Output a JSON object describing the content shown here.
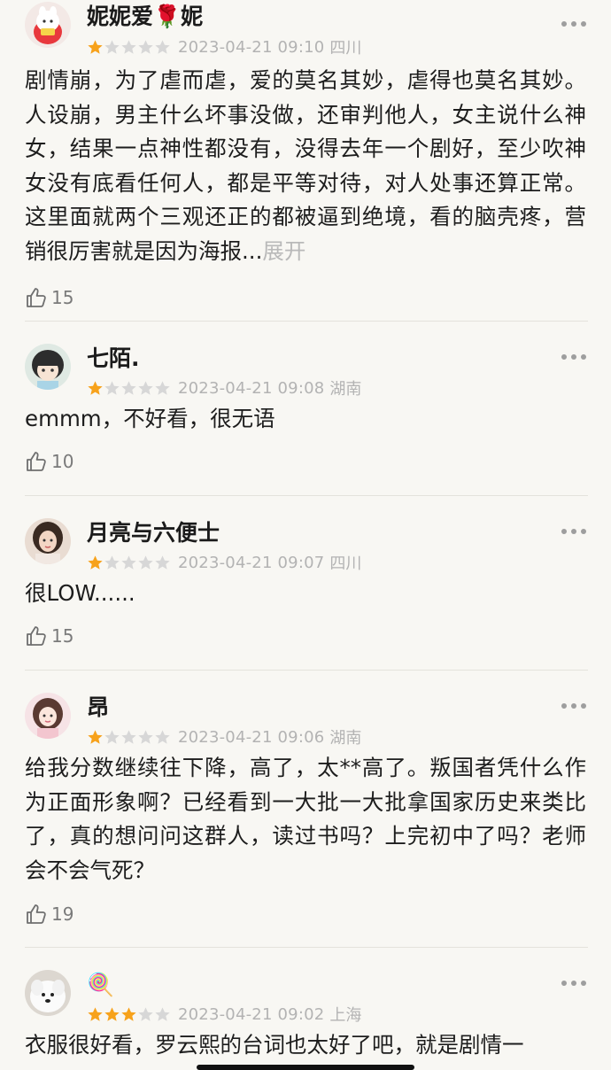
{
  "colors": {
    "background": "#f8f7f3",
    "star_filled": "#f7a21b",
    "star_empty": "#d7d7d7",
    "meta_text": "#b3b3b3"
  },
  "icons": {
    "more": "more-dots-icon",
    "like": "thumbs-up-icon",
    "star": "star-icon"
  },
  "reviews": [
    {
      "username": "妮妮爱🌹妮",
      "rating": 1,
      "max_rating": 5,
      "time": "2023-04-21 09:10",
      "region": "四川",
      "text": "剧情崩，为了虐而虐，爱的莫名其妙，虐得也莫名其妙。人设崩，男主什么坏事没做，还审判他人，女主说什么神女，结果一点神性都没有，没得去年一个剧好，至少吹神女没有底看任何人，都是平等对待，对人处事还算正常。这里面就两个三观还正的都被逼到绝境，看的脑壳疼，营销很厉害就是因为海报...",
      "expand_label": "展开",
      "likes": "15"
    },
    {
      "username": "七陌.",
      "rating": 1,
      "max_rating": 5,
      "time": "2023-04-21 09:08",
      "region": "湖南",
      "text": "emmm，不好看，很无语",
      "likes": "10"
    },
    {
      "username": "月亮与六便士",
      "rating": 1,
      "max_rating": 5,
      "time": "2023-04-21 09:07",
      "region": "四川",
      "text": "很LOW......",
      "likes": "15"
    },
    {
      "username": "昂",
      "rating": 1,
      "max_rating": 5,
      "time": "2023-04-21 09:06",
      "region": "湖南",
      "text": "给我分数继续往下降，高了，太**高了。叛国者凭什么作为正面形象啊？已经看到一大批一大批拿国家历史来类比了，真的想问问这群人，读过书吗？上完初中了吗？老师会不会气死？",
      "likes": "19"
    },
    {
      "username": "🍭",
      "rating": 3,
      "max_rating": 5,
      "time": "2023-04-21 09:02",
      "region": "上海",
      "text": "衣服很好看，罗云熙的台词也太好了吧，就是剧情一"
    }
  ]
}
